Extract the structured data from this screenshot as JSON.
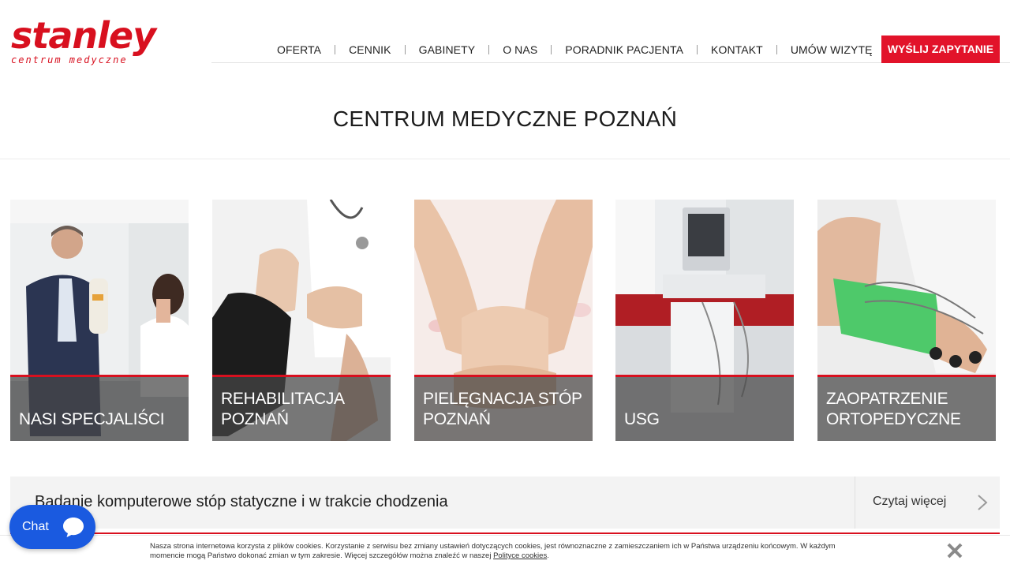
{
  "brand": {
    "name": "stanley",
    "tagline": "centrum medyczne",
    "color": "#d8101f"
  },
  "nav": {
    "items": [
      {
        "label": "OFERTA"
      },
      {
        "label": "CENNIK"
      },
      {
        "label": "GABINETY"
      },
      {
        "label": "O NAS"
      },
      {
        "label": "PORADNIK PACJENTA"
      },
      {
        "label": "KONTAKT"
      },
      {
        "label": "UMÓW WIZYTĘ"
      }
    ],
    "cta_label": "WYŚLIJ ZAPYTANIE",
    "cta_color": "#e2132a"
  },
  "page": {
    "title": "CENTRUM MEDYCZNE POZNAŃ"
  },
  "cards": [
    {
      "label": "NASI SPECJALIŚCI"
    },
    {
      "label": "REHABILITACJA POZNAŃ"
    },
    {
      "label": "PIELĘGNACJA STÓP POZNAŃ"
    },
    {
      "label": "USG"
    },
    {
      "label": "ZAOPATRZENIE ORTOPEDYCZNE"
    }
  ],
  "article": {
    "title": "Badanie komputerowe stóp statyczne i w trakcie chodzenia",
    "more_label": "Czytaj więcej"
  },
  "cookie": {
    "text": "Nasza strona internetowa korzysta z plików cookies. Korzystanie z serwisu bez zmiany ustawień dotyczących cookies, jest równoznaczne z zamieszczaniem ich w Państwa urządzeniu końcowym. W każdym momencie mogą Państwo dokonać zmian w tym zakresie. Więcej szczegółów można znaleźć w naszej ",
    "link_label": "Polityce cookies",
    "link_suffix": "."
  },
  "chat": {
    "label": "Chat",
    "color": "#1a5ae0"
  }
}
